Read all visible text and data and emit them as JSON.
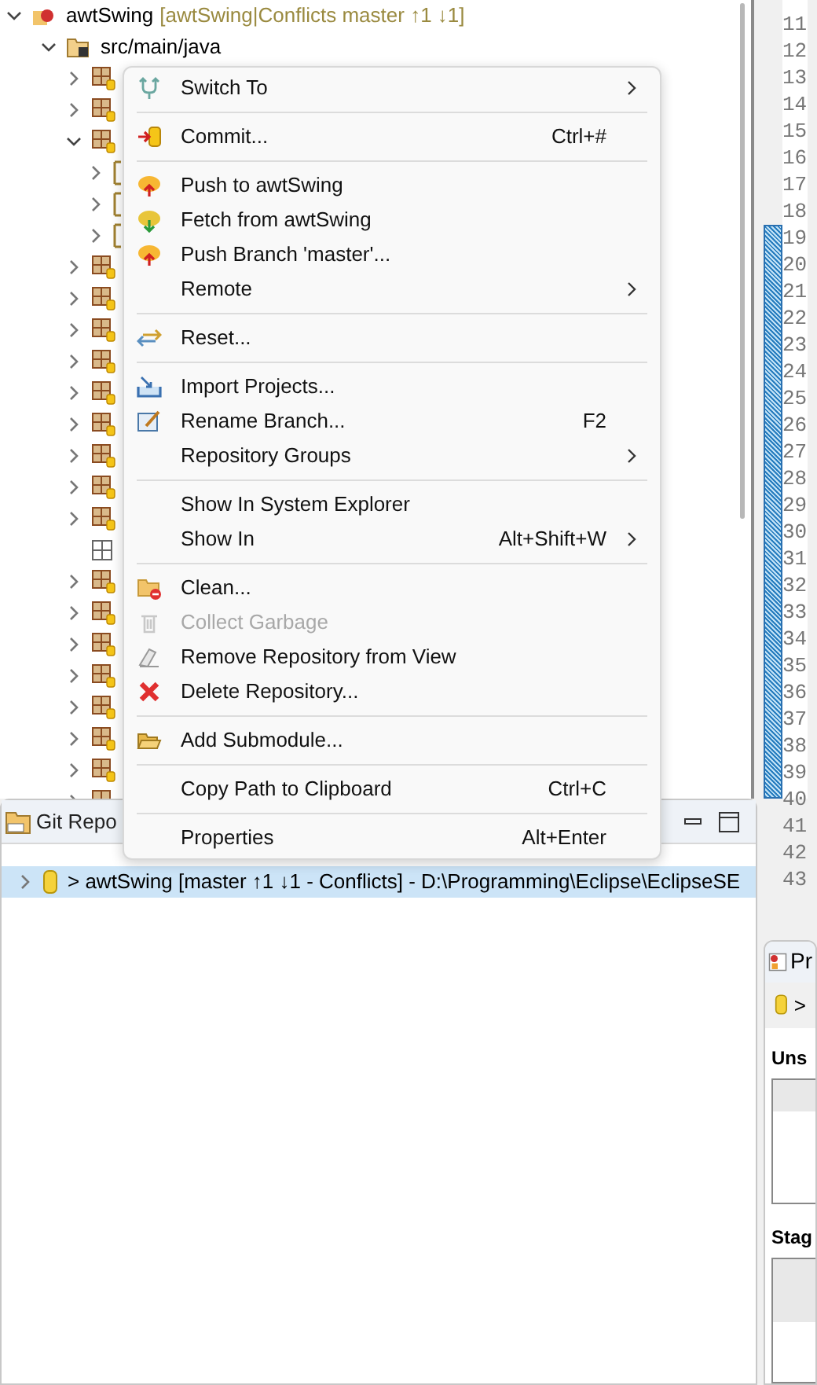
{
  "project_explorer": {
    "project": {
      "label": "awtSwing",
      "decoration": "[awtSwing|Conflicts master ↑1 ↓1]",
      "expanded": true
    },
    "source_folder": {
      "label": "src/main/java",
      "expanded": true
    },
    "packages": [
      {
        "kind": "package",
        "expanded": false
      },
      {
        "kind": "package",
        "expanded": false
      },
      {
        "kind": "package",
        "expanded": true,
        "children": [
          {
            "kind": "folder",
            "expanded": false
          },
          {
            "kind": "folder",
            "expanded": false
          },
          {
            "kind": "folder",
            "expanded": false
          }
        ]
      },
      {
        "kind": "package",
        "expanded": false
      },
      {
        "kind": "package",
        "expanded": false
      },
      {
        "kind": "package",
        "expanded": false
      },
      {
        "kind": "package",
        "expanded": false
      },
      {
        "kind": "package",
        "expanded": false
      },
      {
        "kind": "package",
        "expanded": false
      },
      {
        "kind": "package",
        "expanded": false
      },
      {
        "kind": "package",
        "expanded": false
      },
      {
        "kind": "package",
        "expanded": false
      },
      {
        "kind": "empty-package"
      },
      {
        "kind": "package",
        "expanded": false
      },
      {
        "kind": "package",
        "expanded": false
      },
      {
        "kind": "package",
        "expanded": false
      },
      {
        "kind": "package",
        "expanded": false
      },
      {
        "kind": "package",
        "expanded": false
      },
      {
        "kind": "package",
        "expanded": false
      },
      {
        "kind": "package",
        "expanded": false
      },
      {
        "kind": "package",
        "expanded": false
      }
    ]
  },
  "editor": {
    "line_numbers": [
      "11",
      "12",
      "13",
      "14",
      "15",
      "16",
      "17",
      "18",
      "19",
      "20",
      "21",
      "22",
      "23",
      "24",
      "25",
      "26",
      "27",
      "28",
      "29",
      "30",
      "31",
      "32",
      "33",
      "34",
      "35",
      "36",
      "37",
      "38",
      "39",
      "40",
      "41",
      "42",
      "43"
    ]
  },
  "git_repositories": {
    "tab": "Git Repo",
    "rows": [
      {
        "label": "> awtSwing [master ↑1 ↓1 - Conflicts] - D:\\Programming\\Eclipse\\EclipseSE",
        "selected": true,
        "expanded": false
      }
    ]
  },
  "staging": {
    "tab": "Pr",
    "repo": ">",
    "unstaged": "Uns",
    "staged": "Stag"
  },
  "context_menu": {
    "groups": [
      [
        {
          "label": "Switch To",
          "submenu": true,
          "disabled": false
        }
      ],
      [
        {
          "label": "Commit...",
          "shortcut": "Ctrl+#",
          "submenu": false,
          "disabled": false
        }
      ],
      [
        {
          "label": "Push to awtSwing",
          "submenu": false,
          "disabled": false
        },
        {
          "label": "Fetch from awtSwing",
          "submenu": false,
          "disabled": false
        },
        {
          "label": "Push Branch 'master'...",
          "submenu": false,
          "disabled": false
        },
        {
          "label": "Remote",
          "submenu": true,
          "disabled": false
        }
      ],
      [
        {
          "label": "Reset...",
          "submenu": false,
          "disabled": false
        }
      ],
      [
        {
          "label": "Import Projects...",
          "submenu": false,
          "disabled": false
        },
        {
          "label": "Rename Branch...",
          "shortcut": "F2",
          "submenu": false,
          "disabled": false
        },
        {
          "label": "Repository Groups",
          "submenu": true,
          "disabled": false
        }
      ],
      [
        {
          "label": "Show In System Explorer",
          "submenu": false,
          "disabled": false
        },
        {
          "label": "Show In",
          "shortcut": "Alt+Shift+W",
          "submenu": true,
          "disabled": false
        }
      ],
      [
        {
          "label": "Clean...",
          "submenu": false,
          "disabled": false
        },
        {
          "label": "Collect Garbage",
          "submenu": false,
          "disabled": true
        },
        {
          "label": "Remove Repository from View",
          "submenu": false,
          "disabled": false
        },
        {
          "label": "Delete Repository...",
          "submenu": false,
          "disabled": false
        }
      ],
      [
        {
          "label": "Add Submodule...",
          "submenu": false,
          "disabled": false
        }
      ],
      [
        {
          "label": "Copy Path to Clipboard",
          "shortcut": "Ctrl+C",
          "submenu": false,
          "disabled": false
        }
      ],
      [
        {
          "label": "Properties",
          "shortcut": "Alt+Enter",
          "submenu": false,
          "disabled": false
        }
      ]
    ]
  }
}
